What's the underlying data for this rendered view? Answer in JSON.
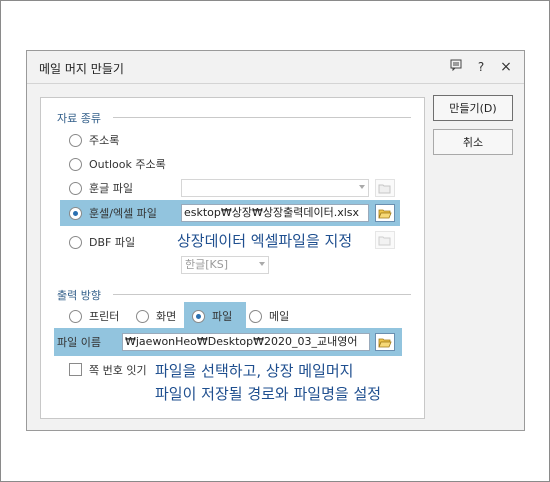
{
  "dialog": {
    "title": "메일 머지 만들기",
    "titlebar_icons": [
      "comment-icon",
      "help-icon",
      "close-icon"
    ],
    "help_glyph": "?",
    "close_glyph": "×"
  },
  "data_type": {
    "section_label": "자료 종류",
    "options": [
      {
        "label": "주소록",
        "checked": false
      },
      {
        "label": "Outlook 주소록",
        "checked": false
      },
      {
        "label": "훈글 파일",
        "checked": false
      },
      {
        "label": "훈셀/엑셀 파일",
        "checked": true
      },
      {
        "label": "DBF 파일",
        "checked": false
      }
    ],
    "hangul_file_value": "",
    "excel_file_value": "esktop₩상장₩상장출력데이터.xlsx",
    "dbf_encoding": "한글[KS]"
  },
  "output": {
    "section_label": "출력 방향",
    "options": [
      {
        "label": "프린터",
        "checked": false
      },
      {
        "label": "화면",
        "checked": false
      },
      {
        "label": "파일",
        "checked": true
      },
      {
        "label": "메일",
        "checked": false
      }
    ],
    "file_name_label": "파일 이름",
    "file_name_value": "₩jaewonHeo₩Desktop₩2020_03_교내영어",
    "page_number_label": "쪽 번호 잇기"
  },
  "buttons": {
    "create": "만들기(D)",
    "cancel": "취소"
  },
  "annotations": {
    "excel_note": "상장데이터 엑셀파일을 지정",
    "file_note_line1": "파일을 선택하고, 상장 메일머지",
    "file_note_line2": "파일이 저장될 경로와 파일명을 설정"
  },
  "colors": {
    "highlight": "#92c4de",
    "annotation_text": "#1f4f8f",
    "section_label": "#335f8a",
    "radio_checked": "#2a6fb0"
  }
}
